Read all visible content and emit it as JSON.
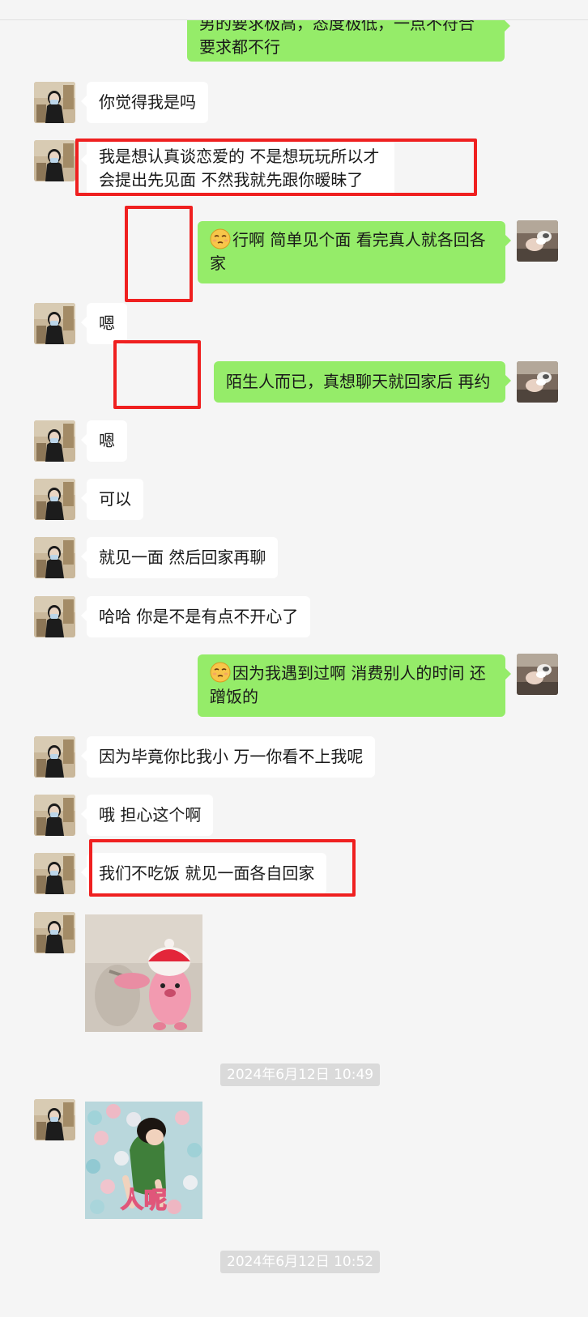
{
  "colors": {
    "background": "#f5f5f5",
    "bubble_self": "#95ec69",
    "bubble_other": "#ffffff",
    "annotation": "#ef2020",
    "timestamp_bg": "#dadada"
  },
  "messages": [
    {
      "sender": "self",
      "text": "男的要求极高，态度极低，一点不符合要求都不行",
      "line1": "男的要求极高，态度极低，一点不符合",
      "line2": "要求都不行"
    },
    {
      "sender": "other",
      "text": "你觉得我是吗"
    },
    {
      "sender": "other",
      "line1": "我是想认真谈恋爱的 不是想玩玩所以才",
      "line2": "会提出先见面 不然我就先跟你暧昧了"
    },
    {
      "sender": "self",
      "emoji": "smirk-emoji",
      "line1": "行啊  简单见个面 看完真人就各回各",
      "line2": "家"
    },
    {
      "sender": "other",
      "text": "嗯"
    },
    {
      "sender": "self",
      "text": "陌生人而已，真想聊天就回家后 再约"
    },
    {
      "sender": "other",
      "text": "嗯"
    },
    {
      "sender": "other",
      "text": "可以"
    },
    {
      "sender": "other",
      "text": "就见一面 然后回家再聊"
    },
    {
      "sender": "other",
      "text": "哈哈 你是不是有点不开心了"
    },
    {
      "sender": "self",
      "emoji": "smirk-emoji",
      "line1": "因为我遇到过啊  消费别人的时间 还",
      "line2": "蹭饭的"
    },
    {
      "sender": "other",
      "text": "因为毕竟你比我小 万一你看不上我呢"
    },
    {
      "sender": "other",
      "text": "哦 担心这个啊"
    },
    {
      "sender": "other",
      "text": "我们不吃饭 就见一面各自回家"
    }
  ],
  "stickers": [
    {
      "sender": "other",
      "name": "pink-beaver-sticker",
      "caption": ""
    },
    {
      "sender": "other",
      "name": "child-ball-pit-sticker",
      "caption": "人呢"
    }
  ],
  "timestamps": [
    "2024年6月12日 10:49",
    "2024年6月12日 10:52"
  ],
  "icons": {
    "other_avatar": "woman-with-mask-avatar",
    "self_avatar": "cat-avatar"
  }
}
